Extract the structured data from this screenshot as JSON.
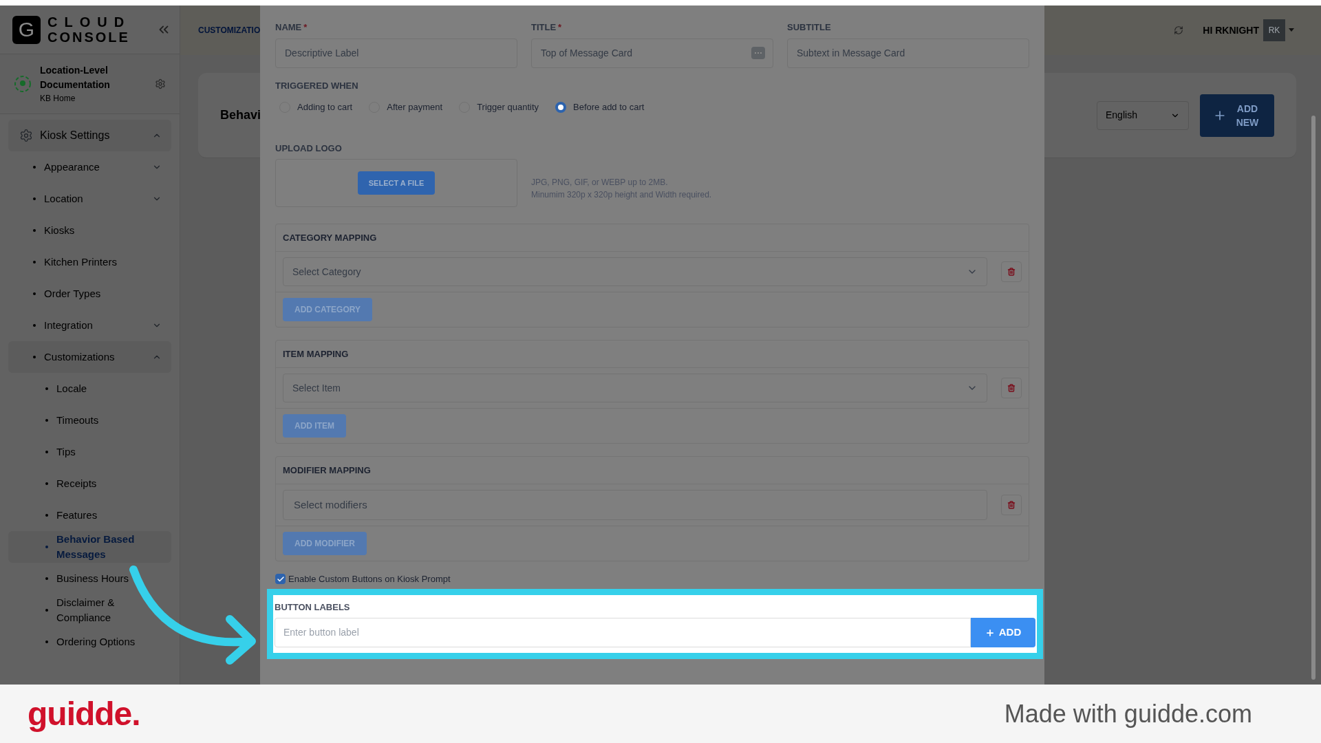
{
  "brand": {
    "logo_letter": "G",
    "line1": "CLOUD",
    "line2": "CONSOLE"
  },
  "location": {
    "name": "Location-Level Documentation",
    "sub": "KB Home"
  },
  "sidebar": {
    "items": [
      {
        "label": "Kiosk Settings",
        "kind": "section",
        "expanded": true,
        "children": [
          {
            "label": "Appearance",
            "kind": "group",
            "expanded": false
          },
          {
            "label": "Location",
            "kind": "group",
            "expanded": false
          },
          {
            "label": "Kiosks",
            "kind": "link",
            "selected": false
          },
          {
            "label": "Kitchen Printers",
            "kind": "link",
            "selected": false
          },
          {
            "label": "Order Types",
            "kind": "link",
            "selected": false
          },
          {
            "label": "Integration",
            "kind": "group",
            "expanded": false
          },
          {
            "label": "Customizations",
            "kind": "group",
            "expanded": true,
            "children": [
              {
                "label": "Locale",
                "kind": "link",
                "selected": false
              },
              {
                "label": "Timeouts",
                "kind": "link",
                "selected": false
              },
              {
                "label": "Tips",
                "kind": "link",
                "selected": false
              },
              {
                "label": "Receipts",
                "kind": "link",
                "selected": false
              },
              {
                "label": "Features",
                "kind": "link",
                "selected": false
              },
              {
                "label": "Behavior Based Messages",
                "kind": "link",
                "selected": true
              },
              {
                "label": "Business Hours",
                "kind": "link",
                "selected": false
              },
              {
                "label": "Disclaimer & Compliance",
                "kind": "link",
                "selected": false
              },
              {
                "label": "Ordering Options",
                "kind": "link",
                "selected": false
              }
            ]
          }
        ]
      }
    ]
  },
  "breadcrumb": "CUSTOMIZATIO",
  "header": {
    "greeting": "HI RKNIGHT",
    "avatar": "RK"
  },
  "page": {
    "title": "Behavi",
    "language": "English",
    "add_new": "ADD NEW"
  },
  "modal": {
    "fields": [
      {
        "label": "NAME",
        "required_mark": "*",
        "placeholder": "Descriptive Label",
        "kind": "text"
      },
      {
        "label": "TITLE",
        "required_mark": "*",
        "placeholder": "Top of Message Card",
        "kind": "rich"
      },
      {
        "label": "SUBTITLE",
        "placeholder": "Subtext in Message Card",
        "kind": "text"
      }
    ],
    "triggered_when": {
      "label": "TRIGGERED WHEN",
      "options": [
        {
          "label": "Adding to cart",
          "selected": false
        },
        {
          "label": "After payment",
          "selected": false
        },
        {
          "label": "Trigger quantity",
          "selected": false
        },
        {
          "label": "Before add to cart",
          "selected": true
        }
      ]
    },
    "upload": {
      "label": "UPLOAD LOGO",
      "button": "SELECT A FILE",
      "hint1": "JPG, PNG, GIF, or WEBP up to 2MB.",
      "hint2": "Minumim 320p x 320p height and Width required."
    },
    "mappings": [
      {
        "title": "CATEGORY MAPPING",
        "placeholder": "Select Category",
        "kind": "dropdown",
        "button": "ADD CATEGORY"
      },
      {
        "title": "ITEM MAPPING",
        "placeholder": "Select Item",
        "kind": "dropdown",
        "button": "ADD ITEM"
      },
      {
        "title": "MODIFIER MAPPING",
        "placeholder": "Select modifiers",
        "kind": "multi",
        "button": "ADD MODIFIER"
      }
    ],
    "custom_buttons": {
      "label": "Enable Custom Buttons on Kiosk Prompt",
      "checked": true
    },
    "button_labels": {
      "label": "BUTTON LABELS",
      "placeholder": "Enter button label",
      "add": "ADD"
    }
  },
  "footer": {
    "logo": "guidde.",
    "credit": "Made with guidde.com"
  }
}
